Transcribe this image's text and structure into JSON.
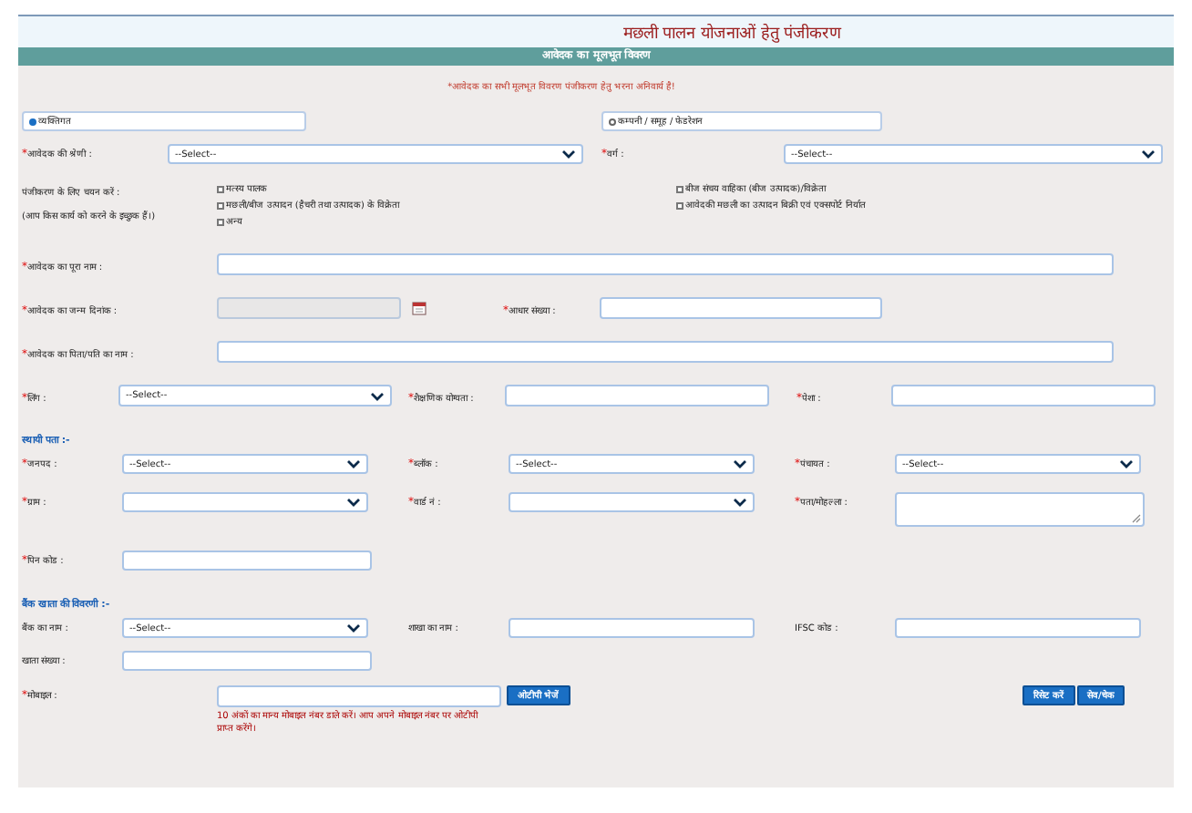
{
  "title": "मछली पालन योजनाओं हेतु पंजीकरण",
  "section_header": "आवेदक का मूलभूत विवरण",
  "notice": "*आवेदक का सभी मूलभूत विवरण पंजीकरण हेतु भरना अनिवार्य है!",
  "applicant_types": [
    {
      "label": "व्यक्तिगत",
      "selected": true
    },
    {
      "label": "कम्पनी / समूह / फेडरेशन",
      "selected": false
    }
  ],
  "category_row": [
    {
      "label": "आवेदक की श्रेणी :",
      "asterisk": "*",
      "kind": "select",
      "value": "--Select--",
      "disabled": false
    },
    {
      "label": "वर्ग :",
      "asterisk": "*",
      "kind": "select",
      "value": "--Select--",
      "disabled": false
    }
  ],
  "registration": {
    "label": "पंजीकरण के लिए चयन करें :",
    "hint": "(आप किस कार्य को करने के इच्छुक हैं।)",
    "options": [
      {
        "label": "मत्स्य पालक",
        "checked": false
      },
      {
        "label": "मछली/बीज उत्पादन (हैचरी तथा उत्पादक) के विक्रेता",
        "checked": false
      },
      {
        "label": "अन्य",
        "checked": false
      },
      {
        "label": "बीज संचय वाहिका (बीज उत्पादक)/विक्रेता",
        "checked": false
      },
      {
        "label": "आवेदकी मछली का उत्पादन बिक्री एवं एक्सपोर्ट निर्यात",
        "checked": false
      }
    ]
  },
  "personal_rows": [
    [
      {
        "label": "आवेदक का पूरा नाम :",
        "asterisk": "*",
        "kind": "text",
        "disabled": false
      }
    ],
    [
      {
        "label": "आवेदक का जन्म दिनांक :",
        "asterisk": "*",
        "kind": "date",
        "disabled": true
      },
      {
        "label": "आधार संख्या :",
        "asterisk": "*",
        "kind": "text",
        "disabled": false
      }
    ],
    [
      {
        "label": "आवेदक का पिता/पति का नाम :",
        "asterisk": "*",
        "kind": "text",
        "disabled": false
      }
    ],
    [
      {
        "label": "लिंग :",
        "asterisk": "*",
        "kind": "select",
        "value": "--Select--",
        "disabled": false
      },
      {
        "label": "शैक्षणिक योग्यता :",
        "asterisk": "*",
        "kind": "text",
        "disabled": false
      },
      {
        "label": "पेशा :",
        "asterisk": "*",
        "kind": "text",
        "disabled": false
      }
    ]
  ],
  "address": {
    "heading": "स्थायी पता :-",
    "rows": [
      [
        {
          "label": "जनपद :",
          "asterisk": "*",
          "kind": "select",
          "value": "--Select--",
          "disabled": false
        },
        {
          "label": "ब्लॉक :",
          "asterisk": "*",
          "kind": "select",
          "value": "--Select--",
          "disabled": false
        },
        {
          "label": "पंचायत :",
          "asterisk": "*",
          "kind": "select",
          "value": "--Select--",
          "disabled": false
        }
      ],
      [
        {
          "label": "ग्राम :",
          "asterisk": "*",
          "kind": "select",
          "disabled": false
        },
        {
          "label": "वार्ड नं :",
          "asterisk": "*",
          "kind": "select",
          "disabled": false
        },
        {
          "label": "पता/मोहल्ला :",
          "asterisk": "*",
          "kind": "textarea",
          "disabled": false
        }
      ],
      [
        {
          "label": "पिन कोड :",
          "asterisk": "*",
          "kind": "text",
          "disabled": false
        }
      ]
    ]
  },
  "bank": {
    "heading": "बैंक खाता की विवरणी :-",
    "rows": [
      [
        {
          "label": "बैंक का नाम :",
          "kind": "select",
          "value": "--Select--",
          "disabled": false
        },
        {
          "label": "शाखा का नाम :",
          "kind": "text",
          "disabled": false
        },
        {
          "label": "IFSC कोड :",
          "kind": "text",
          "disabled": false
        }
      ],
      [
        {
          "label": "खाता संख्या :",
          "kind": "text",
          "disabled": false
        }
      ]
    ]
  },
  "mobile": {
    "label": "मोबाइल :",
    "asterisk": "*",
    "disabled": false,
    "otp_button": "ओटीपी भेजें",
    "hint": "10 अंकों का मान्य मोबाइल नंबर डाले करें। आप अपने मोबाइल नंबर पर ओटीपी प्राप्त करेंगे।"
  },
  "buttons": [
    "रिसेट करें",
    "सेव/चेक"
  ]
}
